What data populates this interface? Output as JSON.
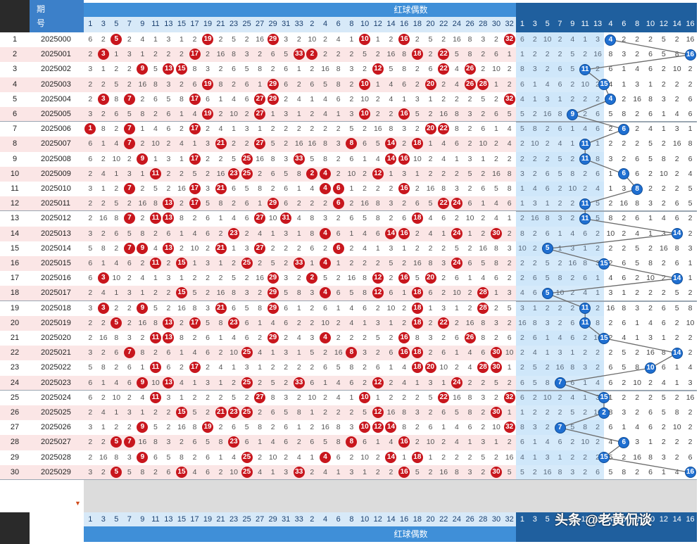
{
  "header": {
    "period_label_1": "期",
    "period_label_2": "号",
    "section_title_even": "红球偶数",
    "odd_numbers": [
      1,
      3,
      5,
      7,
      9,
      11,
      13,
      15,
      17,
      19,
      21,
      23,
      25,
      27,
      29,
      31,
      33
    ],
    "even_numbers": [
      2,
      4,
      6,
      8,
      10,
      12,
      14,
      16,
      18,
      20,
      22,
      24,
      26,
      28,
      30,
      32
    ],
    "right_odd": [
      1,
      3,
      5,
      7,
      9,
      11,
      13
    ],
    "right_even": [
      4,
      6,
      8,
      10,
      12,
      14,
      16
    ]
  },
  "footer": {
    "section_title_even": "红球偶数",
    "watermark": "头条 @老黄侃谈"
  },
  "sort_arrow": "▼",
  "colors": {
    "red_ball": "#c8161d",
    "blue_ball": "#1f6fd1",
    "header_blue": "#3f8fd8"
  },
  "rows": [
    {
      "idx": "1",
      "period": "2025000",
      "red": [
        5,
        19,
        29,
        10,
        16,
        32
      ],
      "blue": 4
    },
    {
      "idx": "2",
      "period": "2025001",
      "red": [
        3,
        17,
        33,
        2,
        18,
        22
      ],
      "blue": 16
    },
    {
      "idx": "3",
      "period": "2025002",
      "red": [
        9,
        13,
        15,
        12,
        22,
        26
      ],
      "blue": 11
    },
    {
      "idx": "4",
      "period": "2025003",
      "red": [
        19,
        29,
        10,
        20,
        26,
        28
      ],
      "blue": 15
    },
    {
      "idx": "5",
      "period": "2025004",
      "red": [
        3,
        7,
        17,
        27,
        29,
        32
      ],
      "blue": 4
    },
    {
      "idx": "6",
      "period": "2025005",
      "red": [
        19,
        27,
        10,
        16
      ],
      "blue": 9
    },
    {
      "idx": "7",
      "period": "2025006",
      "red": [
        1,
        7,
        17,
        20,
        22
      ],
      "blue": 6
    },
    {
      "idx": "8",
      "period": "2025007",
      "red": [
        7,
        21,
        27,
        8,
        14,
        18
      ],
      "blue": 11
    },
    {
      "idx": "9",
      "period": "2025008",
      "red": [
        9,
        17,
        25,
        33,
        14,
        16
      ],
      "blue": 11
    },
    {
      "idx": "10",
      "period": "2025009",
      "red": [
        11,
        23,
        25,
        2,
        4,
        12
      ],
      "blue": 6
    },
    {
      "idx": "11",
      "period": "2025010",
      "red": [
        7,
        17,
        21,
        4,
        6,
        16
      ],
      "blue": 8
    },
    {
      "idx": "12",
      "period": "2025011",
      "red": [
        13,
        17,
        29,
        6,
        22,
        24
      ],
      "blue": 11
    },
    {
      "idx": "13",
      "period": "2025012",
      "red": [
        7,
        11,
        13,
        27,
        31,
        18
      ],
      "blue": 11
    },
    {
      "idx": "14",
      "period": "2025013",
      "red": [
        23,
        4,
        14,
        16,
        24,
        30
      ],
      "blue": 14
    },
    {
      "idx": "15",
      "period": "2025014",
      "red": [
        7,
        9,
        13,
        21,
        27,
        6
      ],
      "blue": 5
    },
    {
      "idx": "16",
      "period": "2025015",
      "red": [
        11,
        15,
        25,
        33,
        4,
        24
      ],
      "blue": 15
    },
    {
      "idx": "17",
      "period": "2025016",
      "red": [
        3,
        29,
        2,
        12,
        16,
        20
      ],
      "blue": 14
    },
    {
      "idx": "18",
      "period": "2025017",
      "red": [
        15,
        29,
        4,
        12,
        18,
        28
      ],
      "blue": 5
    },
    {
      "idx": "19",
      "period": "2025018",
      "red": [
        3,
        9,
        21,
        29,
        18,
        28
      ],
      "blue": 11
    },
    {
      "idx": "20",
      "period": "2025019",
      "red": [
        5,
        13,
        17,
        23,
        18,
        22
      ],
      "blue": 11
    },
    {
      "idx": "21",
      "period": "2025020",
      "red": [
        11,
        13,
        29,
        4,
        16,
        26
      ],
      "blue": 15
    },
    {
      "idx": "22",
      "period": "2025021",
      "red": [
        7,
        25,
        8,
        16,
        18,
        30
      ],
      "blue": 14
    },
    {
      "idx": "23",
      "period": "2025022",
      "red": [
        11,
        17,
        18,
        20,
        28,
        30
      ],
      "blue": 10
    },
    {
      "idx": "24",
      "period": "2025023",
      "red": [
        9,
        13,
        25,
        33,
        12,
        24
      ],
      "blue": 7
    },
    {
      "idx": "25",
      "period": "2025024",
      "red": [
        11,
        27,
        10,
        22,
        32
      ],
      "blue": 15
    },
    {
      "idx": "26",
      "period": "2025025",
      "red": [
        15,
        21,
        23,
        25,
        12,
        30
      ],
      "blue": 2
    },
    {
      "idx": "27",
      "period": "2025026",
      "red": [
        9,
        19,
        10,
        12,
        14,
        32
      ],
      "blue": 7
    },
    {
      "idx": "28",
      "period": "2025027",
      "red": [
        5,
        7,
        23,
        8,
        16
      ],
      "blue": 6
    },
    {
      "idx": "29",
      "period": "2025028",
      "red": [
        9,
        25,
        4,
        14,
        18
      ],
      "blue": 15
    },
    {
      "idx": "30",
      "period": "2025029",
      "red": [
        5,
        15,
        25,
        33,
        16,
        30
      ],
      "blue": 16
    }
  ]
}
